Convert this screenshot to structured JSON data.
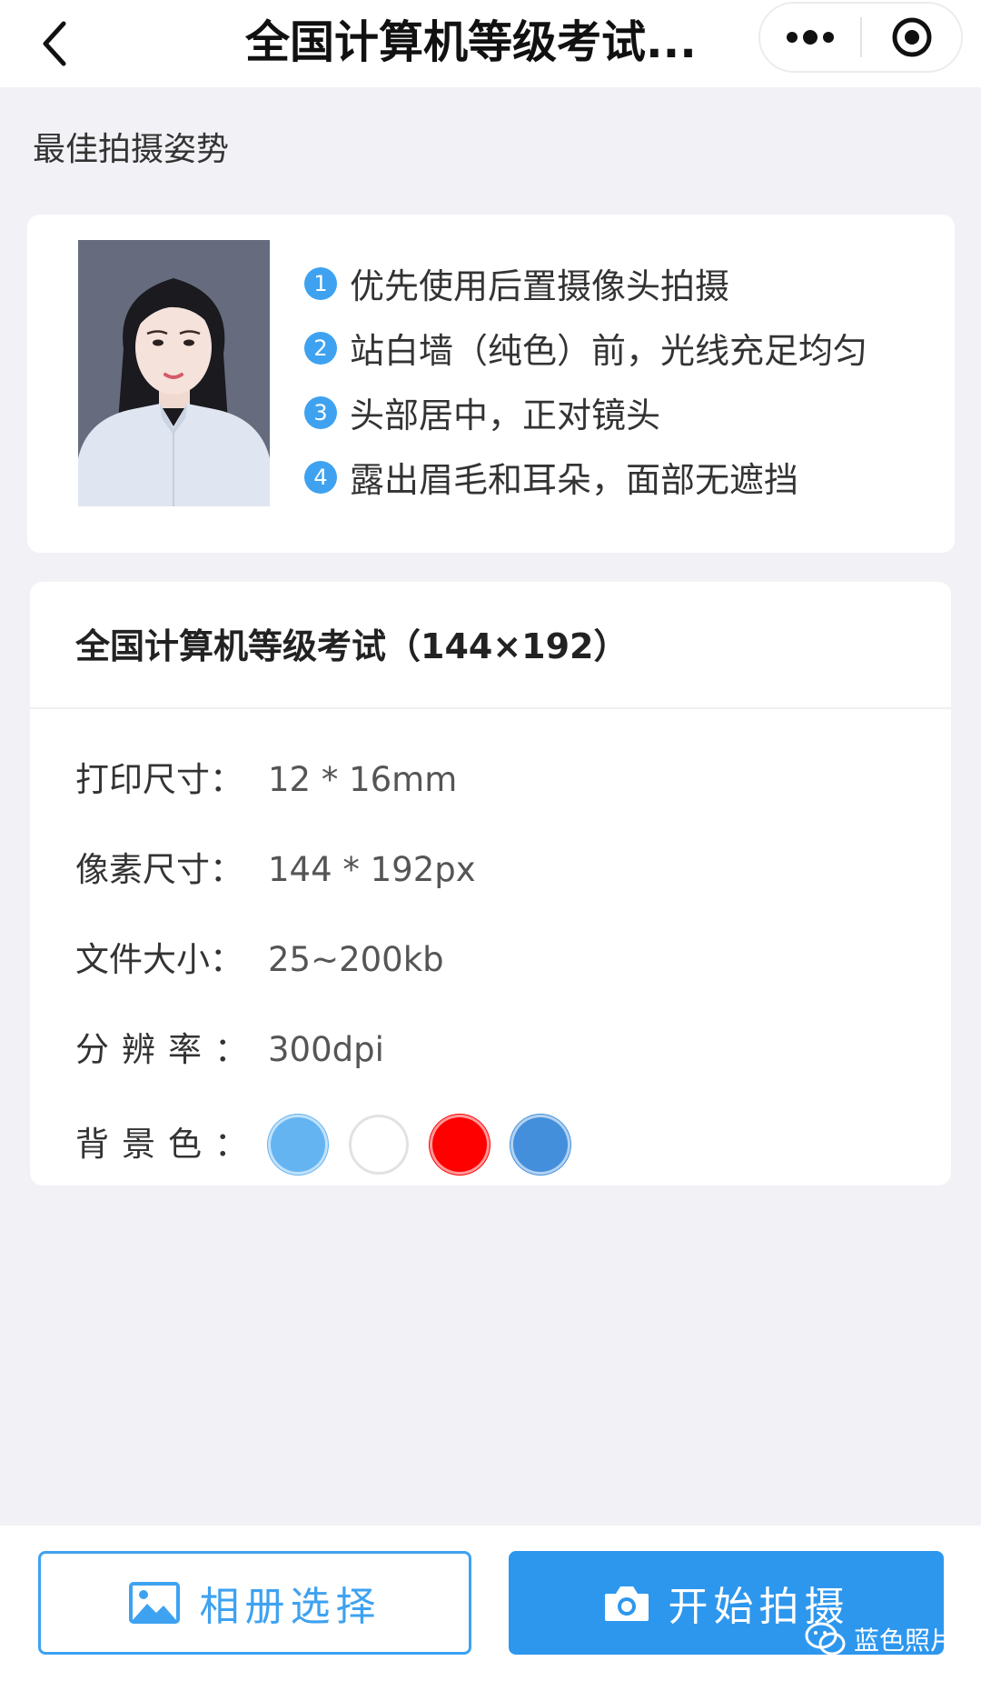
{
  "nav": {
    "title": "全国计算机等级考试...",
    "back_icon": "chevron-left-icon",
    "more_icon": "more-dots-icon",
    "close_icon": "target-circle-icon"
  },
  "pose": {
    "section_title": "最佳拍摄姿势",
    "tips": [
      {
        "num": "1",
        "text": "优先使用后置摄像头拍摄"
      },
      {
        "num": "2",
        "text": "站白墙（纯色）前，光线充足均匀"
      },
      {
        "num": "3",
        "text": "头部居中，正对镜头"
      },
      {
        "num": "4",
        "text": "露出眉毛和耳朵，面部无遮挡"
      }
    ]
  },
  "spec": {
    "title": "全国计算机等级考试（144×192）",
    "rows": [
      {
        "label": "打印尺寸：",
        "value": "12 * 16mm"
      },
      {
        "label": "像素尺寸：",
        "value": "144 * 192px"
      },
      {
        "label": "文件大小：",
        "value": "25~200kb"
      },
      {
        "label": "分辨率：",
        "value": "300dpi"
      }
    ],
    "bg_label": "背景色：",
    "bg_colors": [
      "#64b4f2",
      "#ffffff",
      "#ff0000",
      "#438fdb"
    ]
  },
  "actions": {
    "album_label": "相册选择",
    "album_icon": "image-icon",
    "shoot_label": "开始拍摄",
    "shoot_icon": "camera-icon"
  },
  "watermark": {
    "text": "蓝色照片",
    "icon": "wechat-icon"
  },
  "colors": {
    "accent": "#3ea2f0",
    "primary_button": "#2d97ee",
    "page_bg": "#f2f2f6"
  }
}
